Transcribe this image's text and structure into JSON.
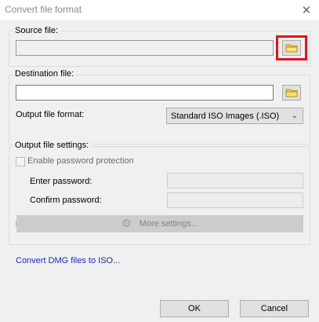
{
  "window": {
    "title": "Convert file format",
    "close_glyph": "✕"
  },
  "source": {
    "group_label": "Source file:",
    "path_value": "",
    "browse_icon": "folder-icon"
  },
  "destination": {
    "group_label": "Destination file:",
    "path_value": "",
    "browse_icon": "folder-icon",
    "format_label": "Output file format:",
    "format_selected": "Standard ISO Images (.ISO)"
  },
  "settings": {
    "group_label": "Output file settings:",
    "password_checkbox_label": "Enable password protection",
    "password_checked": false,
    "enter_password_label": "Enter password:",
    "confirm_password_label": "Confirm password:",
    "more_settings_label": "More settings..."
  },
  "footer": {
    "convert_link": "Convert DMG files to ISO...",
    "ok_label": "OK",
    "cancel_label": "Cancel"
  },
  "colors": {
    "highlight": "#e0141e",
    "link": "#1a2bb8"
  }
}
